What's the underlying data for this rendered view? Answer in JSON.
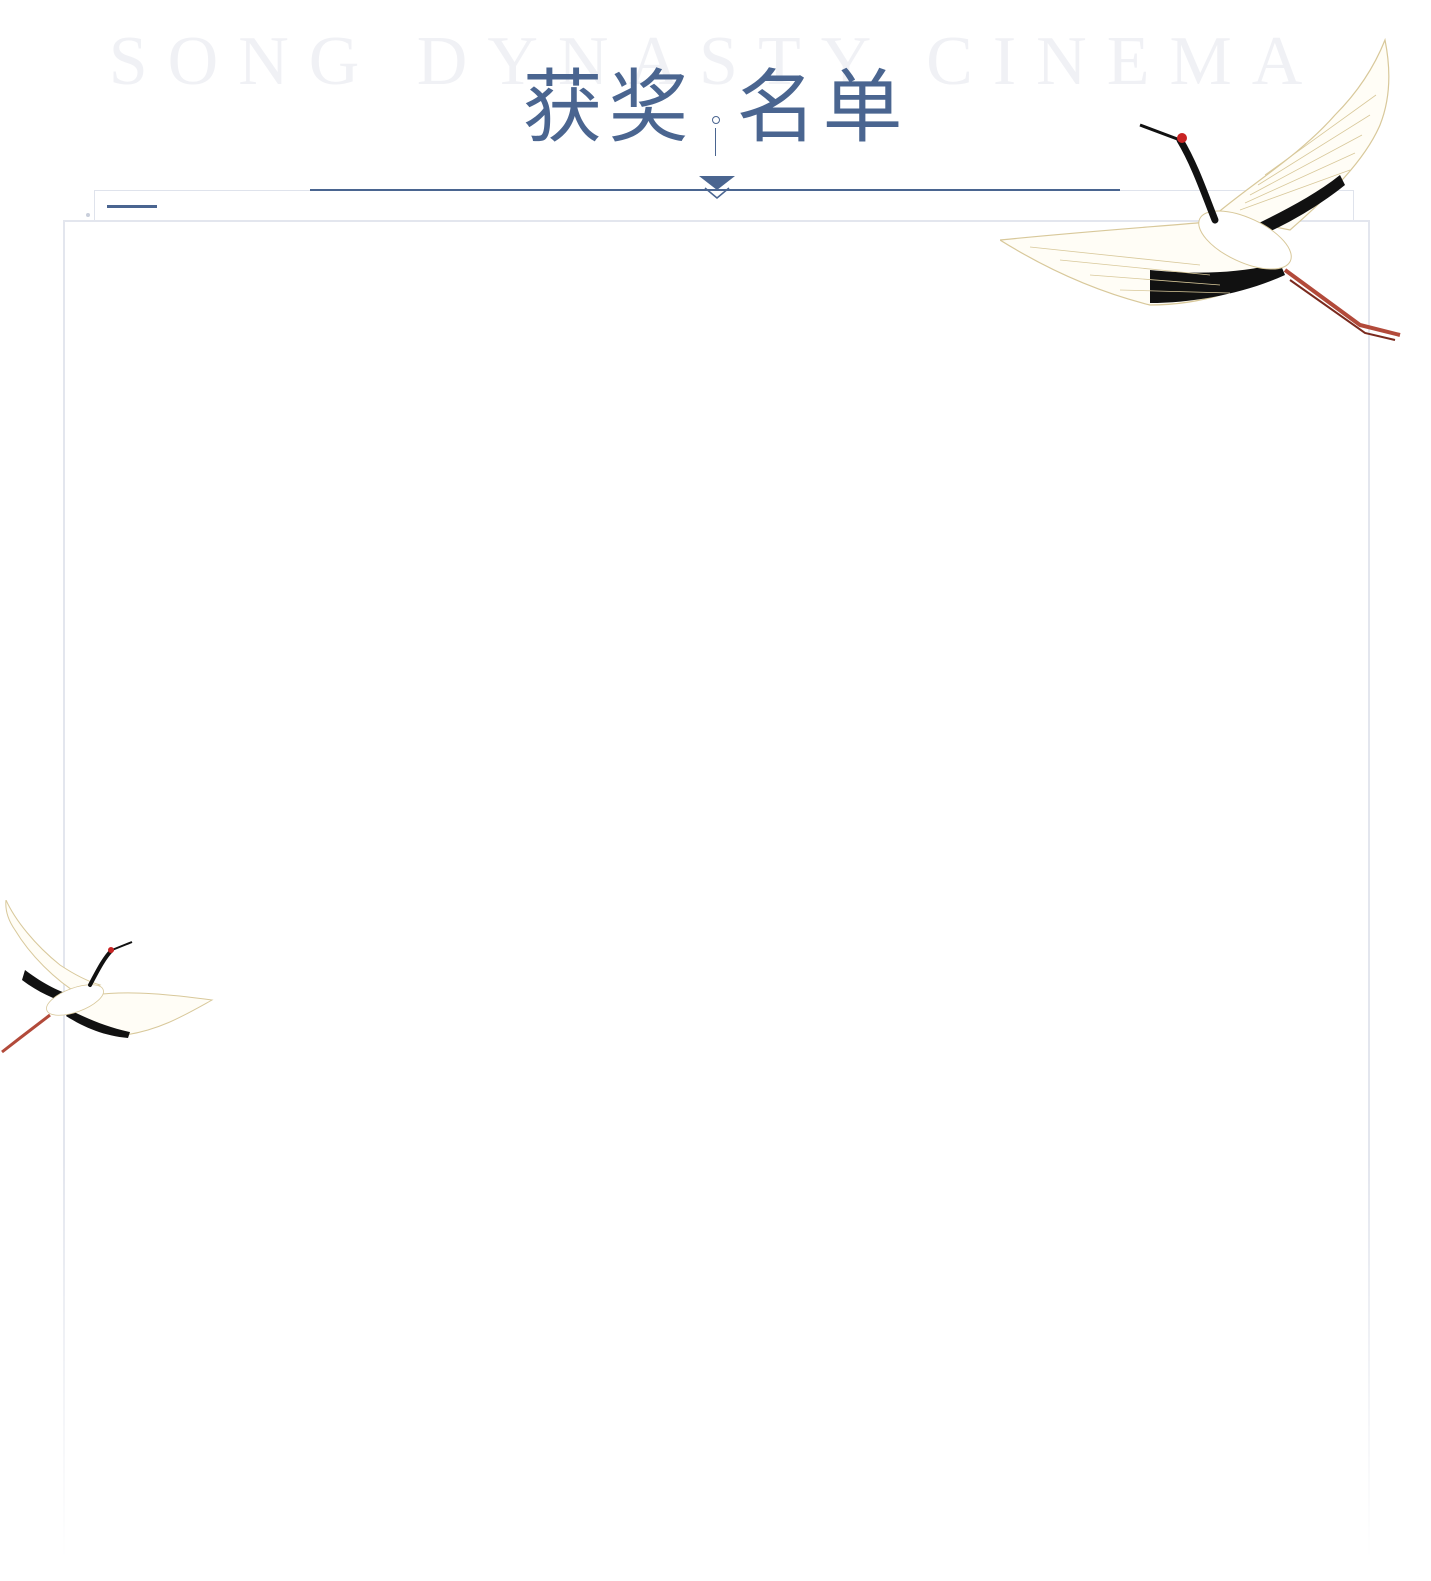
{
  "header": {
    "subtitle_en": "SONG DYNASTY CINEMA",
    "title_left": "获奖",
    "title_right": "名单"
  },
  "colors": {
    "accent": "#4a6590",
    "frame": "#e3e6ee",
    "subtitle": "#f0f1f5"
  },
  "icons": {
    "arrow": "chevron-down-icon",
    "crane_large": "crane-icon",
    "crane_small": "crane-icon"
  }
}
